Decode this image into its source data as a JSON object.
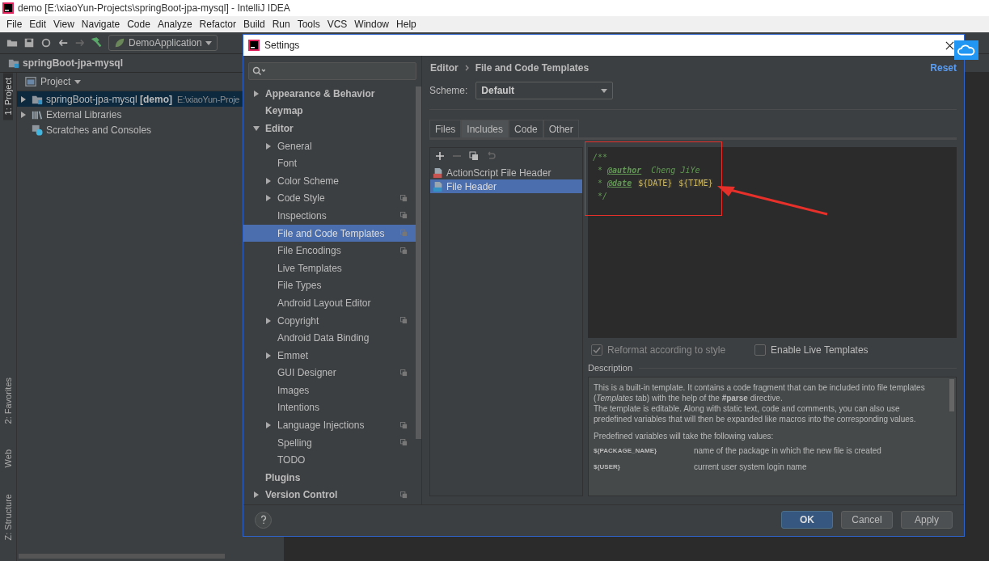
{
  "window": {
    "title": "demo [E:\\xiaoYun-Projects\\springBoot-jpa-mysql] - IntelliJ IDEA"
  },
  "menu": [
    "File",
    "Edit",
    "View",
    "Navigate",
    "Code",
    "Analyze",
    "Refactor",
    "Build",
    "Run",
    "Tools",
    "VCS",
    "Window",
    "Help"
  ],
  "toolbar": {
    "run_config": "DemoApplication"
  },
  "breadcrumb": "springBoot-jpa-mysql",
  "tool_stripe": {
    "top": [
      {
        "label": "1: Project",
        "selected": true
      }
    ],
    "bottom": [
      {
        "label": "2: Favorites",
        "selected": false
      },
      {
        "label": "Web",
        "selected": false
      },
      {
        "label": "Z: Structure",
        "selected": false
      }
    ]
  },
  "project_panel": {
    "title": "Project",
    "items": [
      {
        "label": "springBoot-jpa-mysql **[demo]**",
        "path": "E:\\xiaoYun-Proje",
        "selected": true,
        "expanded": false,
        "kind": "module"
      },
      {
        "label": "External Libraries",
        "selected": false,
        "expanded": false,
        "kind": "libraries"
      },
      {
        "label": "Scratches and Consoles",
        "selected": false,
        "kind": "scratches"
      }
    ]
  },
  "dialog": {
    "title": "Settings",
    "nav": [
      {
        "label": "Appearance & Behavior",
        "expanded": false,
        "selected": false,
        "project_level": false
      },
      {
        "label": "Keymap",
        "selected": false,
        "project_level": false
      },
      {
        "label": "Editor",
        "expanded": true,
        "selected": false,
        "project_level": false,
        "children": [
          {
            "label": "General",
            "expanded": false,
            "selected": false,
            "project_level": false
          },
          {
            "label": "Font",
            "selected": false,
            "project_level": false
          },
          {
            "label": "Color Scheme",
            "expanded": false,
            "selected": false,
            "project_level": false
          },
          {
            "label": "Code Style",
            "expanded": false,
            "selected": false,
            "project_level": true
          },
          {
            "label": "Inspections",
            "selected": false,
            "project_level": true
          },
          {
            "label": "File and Code Templates",
            "selected": true,
            "project_level": true
          },
          {
            "label": "File Encodings",
            "selected": false,
            "project_level": true
          },
          {
            "label": "Live Templates",
            "selected": false,
            "project_level": false
          },
          {
            "label": "File Types",
            "selected": false,
            "project_level": false
          },
          {
            "label": "Android Layout Editor",
            "selected": false,
            "project_level": false
          },
          {
            "label": "Copyright",
            "expanded": false,
            "selected": false,
            "project_level": true
          },
          {
            "label": "Android Data Binding",
            "selected": false,
            "project_level": false
          },
          {
            "label": "Emmet",
            "expanded": false,
            "selected": false,
            "project_level": false
          },
          {
            "label": "GUI Designer",
            "selected": false,
            "project_level": true
          },
          {
            "label": "Images",
            "selected": false,
            "project_level": false
          },
          {
            "label": "Intentions",
            "selected": false,
            "project_level": false
          },
          {
            "label": "Language Injections",
            "expanded": false,
            "selected": false,
            "project_level": true
          },
          {
            "label": "Spelling",
            "selected": false,
            "project_level": true
          },
          {
            "label": "TODO",
            "selected": false,
            "project_level": false
          }
        ]
      },
      {
        "label": "Plugins",
        "selected": false,
        "project_level": false
      },
      {
        "label": "Version Control",
        "expanded": false,
        "selected": false,
        "project_level": true
      }
    ],
    "crumbs": [
      "Editor",
      "File and Code Templates"
    ],
    "reset": "Reset",
    "scheme": {
      "label": "Scheme:",
      "value": "Default"
    },
    "tabs": [
      {
        "label": "Files",
        "selected": false
      },
      {
        "label": "Includes",
        "selected": true
      },
      {
        "label": "Code",
        "selected": false
      },
      {
        "label": "Other",
        "selected": false
      }
    ],
    "templates": [
      {
        "label": "ActionScript File Header",
        "kind": "actionscript",
        "selected": false
      },
      {
        "label": "File Header",
        "kind": "java",
        "selected": true
      }
    ],
    "code": [
      [
        {
          "kind": "comment",
          "text": "/**"
        }
      ],
      [
        {
          "kind": "comment",
          "text": " * "
        },
        {
          "kind": "tag",
          "text": "@author"
        },
        {
          "kind": "comment",
          "text": "  Cheng JiYe"
        }
      ],
      [
        {
          "kind": "comment",
          "text": " * "
        },
        {
          "kind": "tag",
          "text": "@date"
        },
        {
          "kind": "var",
          "text": "${DATE}"
        },
        {
          "kind": "var",
          "text": "${TIME}"
        }
      ],
      [
        {
          "kind": "comment",
          "text": " */"
        }
      ]
    ],
    "options": [
      {
        "label": "Reformat according to style",
        "checked": true,
        "disabled": true
      },
      {
        "label": "Enable Live Templates",
        "checked": false,
        "disabled": false
      }
    ],
    "description": {
      "title": "Description",
      "paragraphs": [
        "This is a built-in template. It contains a code fragment that can be included into file templates (*Templates* tab) with the help of the **#parse** directive.",
        "The template is editable. Along with static text, code and comments, you can also use predefined variables that will then be expanded like macros into the corresponding values."
      ],
      "intro": "Predefined variables will take the following values:",
      "variables": [
        {
          "name": "${PACKAGE_NAME}",
          "meaning": "name of the package in which the new file is created"
        },
        {
          "name": "${USER}",
          "meaning": "current user system login name"
        }
      ]
    },
    "buttons": [
      {
        "label": "OK",
        "kind": "primary"
      },
      {
        "label": "Cancel",
        "kind": "normal"
      },
      {
        "label": "Apply",
        "kind": "normal"
      }
    ]
  }
}
